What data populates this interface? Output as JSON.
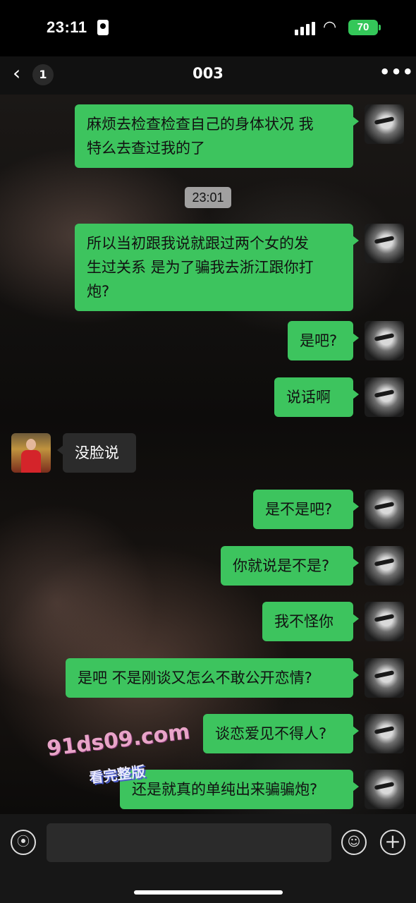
{
  "status_bar": {
    "time": "23:11",
    "battery": "70"
  },
  "nav": {
    "unread_count": "1",
    "title": "003"
  },
  "timestamp": "23:01",
  "messages": [
    {
      "line1": "麻烦去检查检查自己的身体状况 我",
      "line2": "特么去查过我的了"
    },
    {
      "line1": "所以当初跟我说就跟过两个女的发",
      "line2": "生过关系 是为了骗我去浙江跟你打",
      "line3": "炮?"
    },
    {
      "text": "是吧?"
    },
    {
      "text": "说话啊"
    },
    {
      "text": "没脸说"
    },
    {
      "text": "是不是吧?"
    },
    {
      "text": "你就说是不是?"
    },
    {
      "text": "我不怪你"
    },
    {
      "text": "是吧 不是刚谈又怎么不敢公开恋情?"
    },
    {
      "text": "谈恋爱见不得人?"
    },
    {
      "text": "还是就真的单纯出来骗骗炮?"
    }
  ],
  "watermark": {
    "url": "91ds09.com",
    "caption": "看完整版"
  },
  "input": {
    "value": ""
  },
  "icons": {
    "back": "chevron-left-icon",
    "more": "more-dots-icon",
    "voice": "voice-icon",
    "emoji": "emoji-icon",
    "plus": "plus-icon"
  },
  "colors": {
    "outgoing_bubble": "#3dc45e",
    "incoming_bubble": "#2b2b2b",
    "battery": "#34c759"
  }
}
